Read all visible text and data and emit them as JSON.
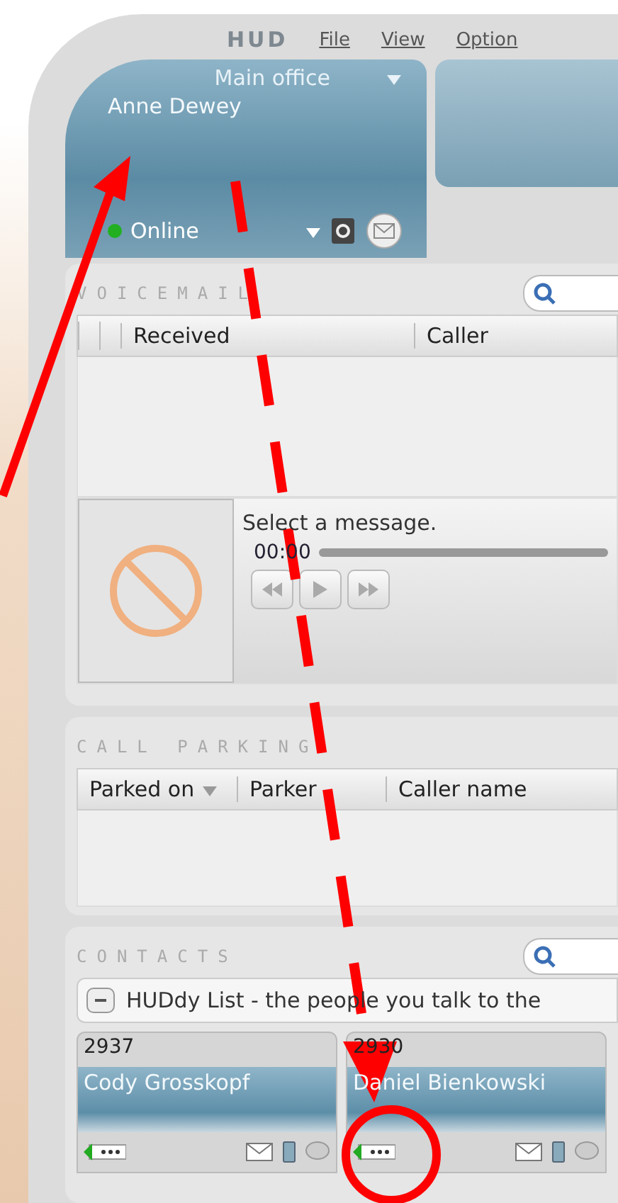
{
  "header": {
    "logo": "HUD",
    "menu": [
      "File",
      "View",
      "Option"
    ]
  },
  "user": {
    "location": "Main office",
    "name": "Anne Dewey",
    "status": "Online",
    "online": true
  },
  "voicemail": {
    "title": "VOICEMAIL",
    "columns": [
      "Received",
      "Caller"
    ],
    "message": "Select a message.",
    "time": "00:00",
    "level": 0
  },
  "call_parking": {
    "title": "CALL PARKING",
    "columns": [
      {
        "label": "Parked on",
        "sorted": true
      },
      {
        "label": "Parker",
        "sorted": false
      },
      {
        "label": "Caller name",
        "sorted": false
      }
    ]
  },
  "contacts": {
    "title": "CONTACTS",
    "group": {
      "label": "HUDdy List - the people you talk to the",
      "expanded": true
    },
    "cards": [
      {
        "extension": "2937",
        "name": "Cody Grosskopf"
      },
      {
        "extension": "2930",
        "name": "Daniel Bienkowski"
      }
    ]
  }
}
